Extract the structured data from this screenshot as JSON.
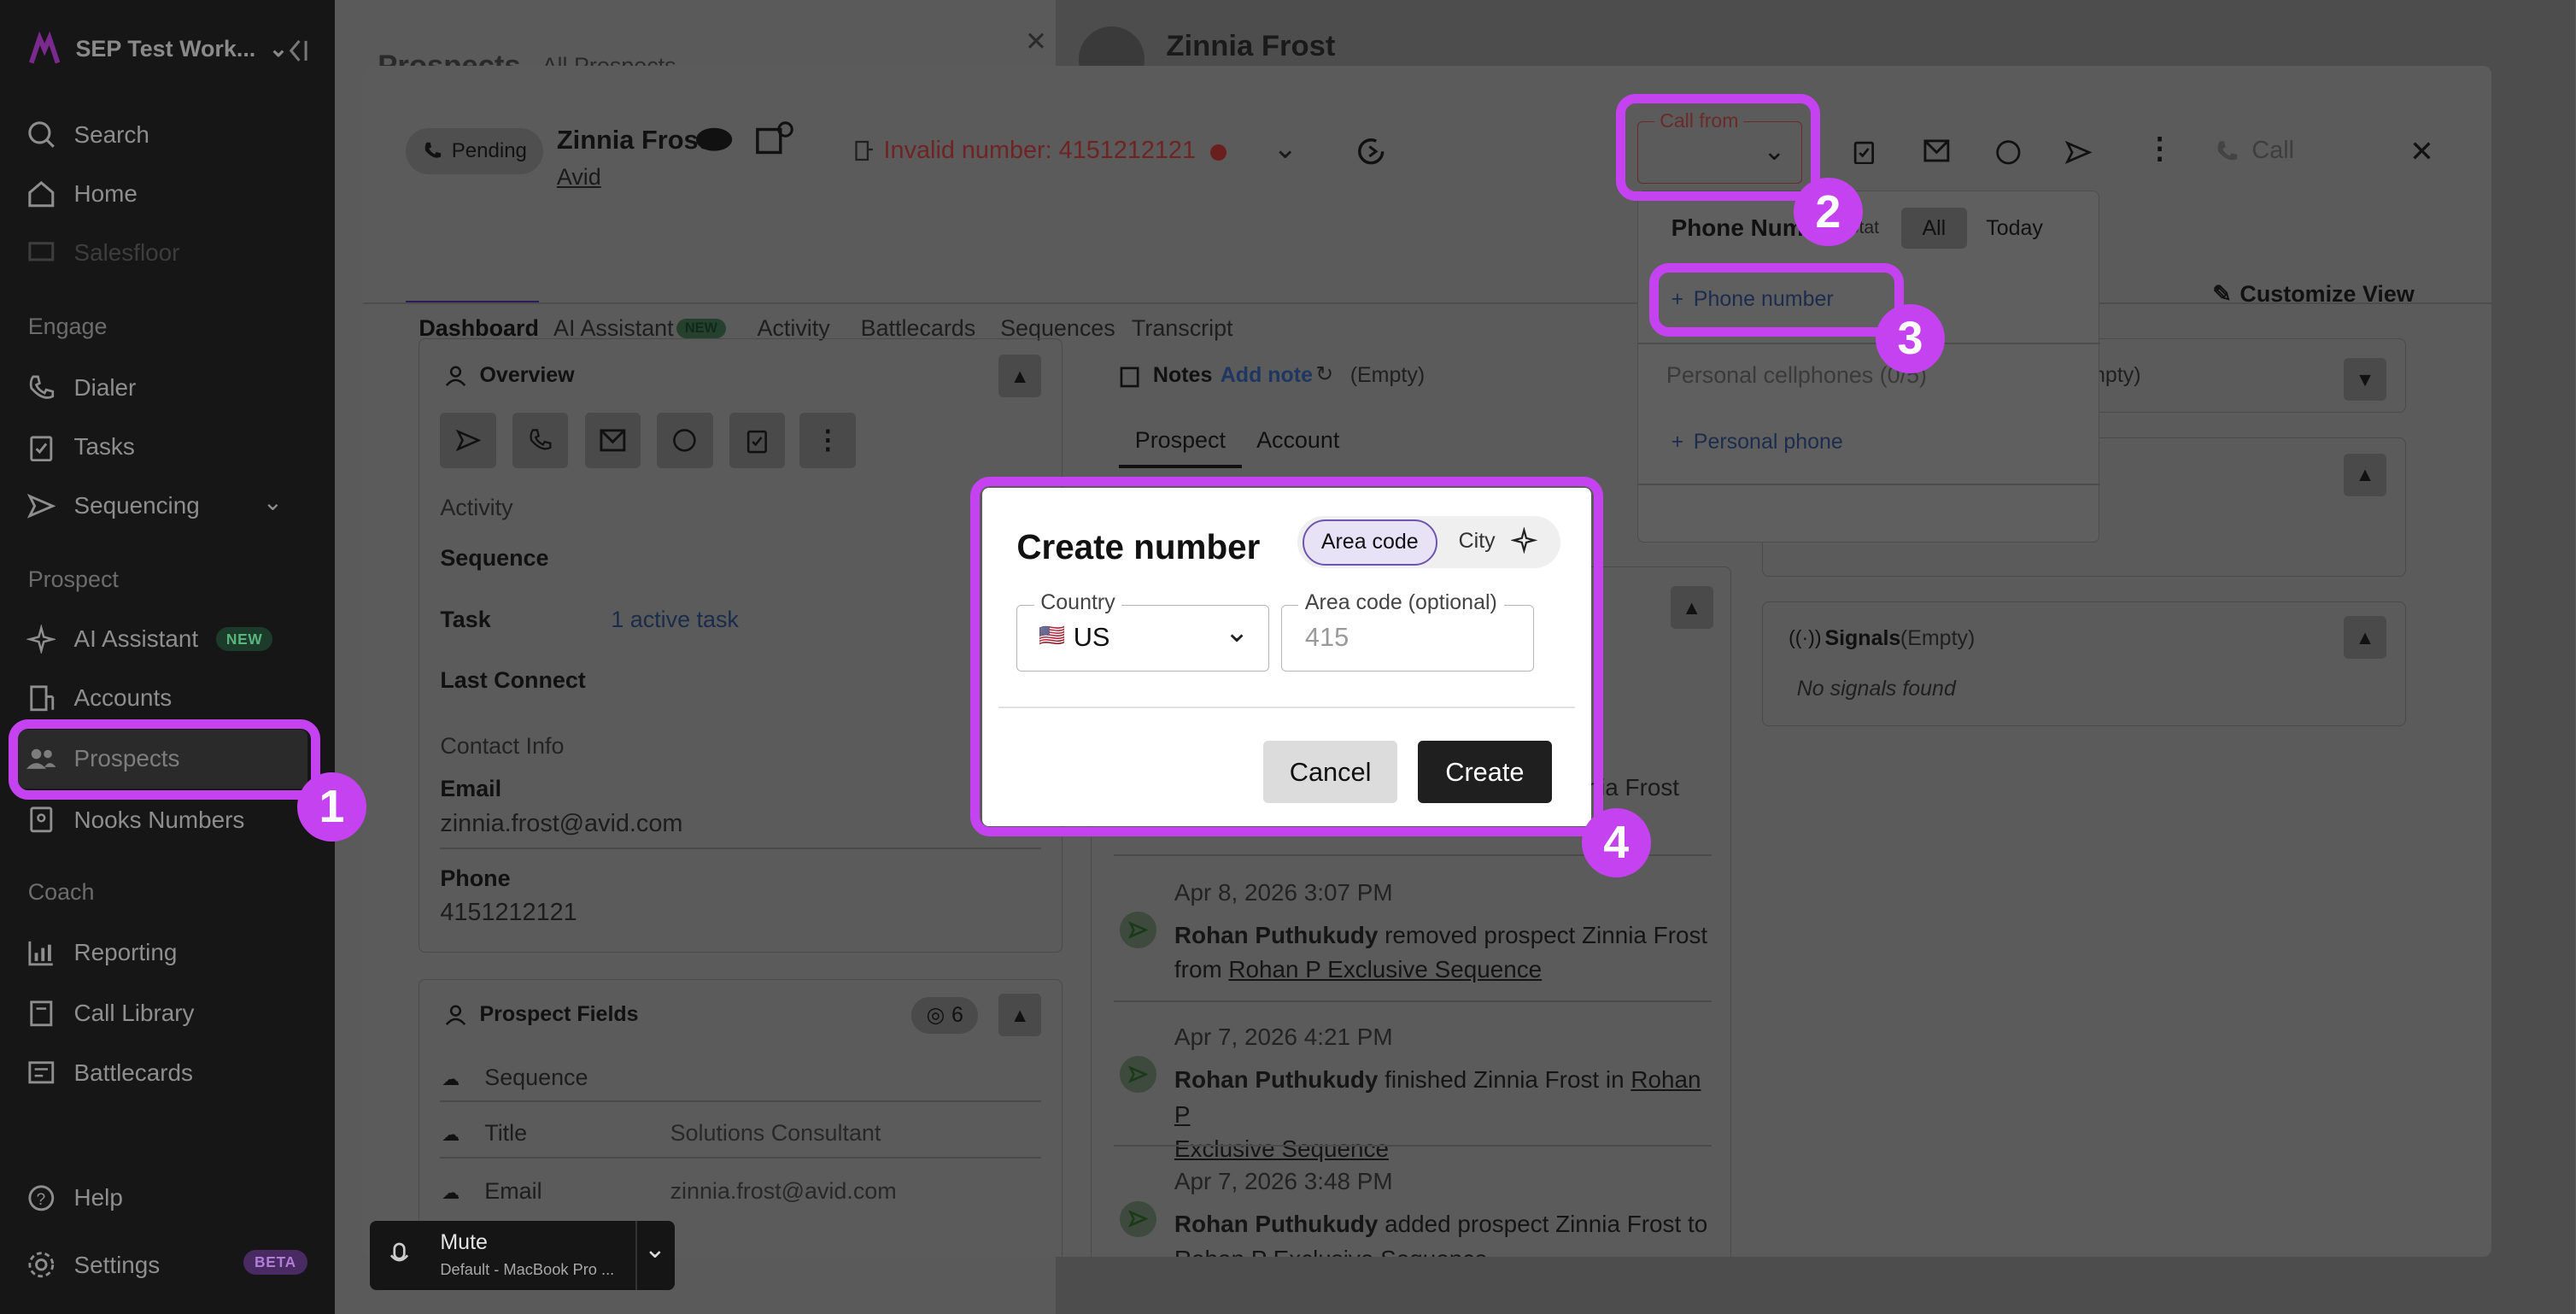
{
  "sidebar": {
    "workspace": "SEP Test Work...",
    "items": {
      "search": "Search",
      "home": "Home",
      "salesfloor": "Salesfloor",
      "dialer": "Dialer",
      "tasks": "Tasks",
      "sequencing": "Sequencing",
      "ai_assistant": "AI Assistant",
      "accounts": "Accounts",
      "prospects": "Prospects",
      "nooks_numbers": "Nooks Numbers",
      "reporting": "Reporting",
      "call_library": "Call Library",
      "battlecards": "Battlecards",
      "help": "Help",
      "settings": "Settings"
    },
    "sections": {
      "engage": "Engage",
      "prospect": "Prospect",
      "coach": "Coach"
    },
    "badges": {
      "new": "NEW",
      "beta": "BETA"
    }
  },
  "background": {
    "page_title": "Prospects",
    "view": "All Prospects",
    "right_name": "Zinnia Frost"
  },
  "header": {
    "status": "Pending",
    "name": "Zinnia Frost",
    "company": "Avid",
    "invalid_number": "Invalid number: 4151212121",
    "call_from_label": "Call from",
    "call_label": "Call"
  },
  "tabs": [
    "Dashboard",
    "AI Assistant",
    "Activity",
    "Battlecards",
    "Sequences",
    "Transcript"
  ],
  "tab_new_badge": "NEW",
  "customize_view": "Customize View",
  "overview": {
    "title": "Overview",
    "activity": "Activity",
    "sequence": "Sequence",
    "task": "Task",
    "task_value": "1 active task",
    "last_connect": "Last Connect",
    "contact_info": "Contact Info",
    "email_label": "Email",
    "email_value": "zinnia.frost@avid.com",
    "phone_label": "Phone",
    "phone_value": "4151212121"
  },
  "prospect_fields": {
    "title": "Prospect Fields",
    "hidden_count": "6",
    "rows": [
      {
        "label": "Sequence",
        "value": ""
      },
      {
        "label": "Title",
        "value": "Solutions Consultant"
      },
      {
        "label": "Email",
        "value": "zinnia.frost@avid.com"
      }
    ]
  },
  "notes": {
    "title": "Notes",
    "add_note": "Add note",
    "empty": "(Empty)",
    "tab_prospect": "Prospect",
    "tab_account": "Account"
  },
  "activity_feed": [
    {
      "partial": "nia Frost"
    },
    {
      "time": "Apr 8, 2026 3:07 PM",
      "actor": "Rohan Puthukudy",
      "text1": " removed prospect Zinnia Frost",
      "text2": "from ",
      "link": "Rohan P Exclusive Sequence"
    },
    {
      "time": "Apr 7, 2026 4:21 PM",
      "actor": "Rohan Puthukudy",
      "text1": " finished Zinnia Frost in ",
      "link1": "Rohan P",
      "link2": "Exclusive Sequence"
    },
    {
      "time": "Apr 7, 2026 3:48 PM",
      "actor": "Rohan Puthukudy",
      "text1": " added prospect Zinnia Frost to",
      "link": "Rohan P Exclusive Sequence"
    }
  ],
  "right_panel": {
    "empty_partial": "mpty)",
    "signals_title": "Signals",
    "signals_empty": "(Empty)",
    "no_signals": "No signals found"
  },
  "dropdown": {
    "title": "Phone Numb",
    "stat": "Stat",
    "filter_all": "All",
    "filter_today": "Today",
    "add_phone": "Phone number",
    "personal_cellphones": "Personal cellphones (0/5)",
    "add_personal": "Personal phone"
  },
  "dialog": {
    "title": "Create number",
    "mode_area_code": "Area code",
    "mode_city": "City",
    "country_label": "Country",
    "country_flag": "🇺🇸",
    "country_value": "US",
    "area_label": "Area code (optional)",
    "area_placeholder": "415",
    "cancel": "Cancel",
    "create": "Create"
  },
  "mute": {
    "label": "Mute",
    "device": "Default - MacBook Pro ..."
  },
  "steps": [
    "1",
    "2",
    "3",
    "4"
  ],
  "colors": {
    "highlight": "#c542f0",
    "invalid": "#b3312f",
    "link": "#2c5fb8"
  }
}
